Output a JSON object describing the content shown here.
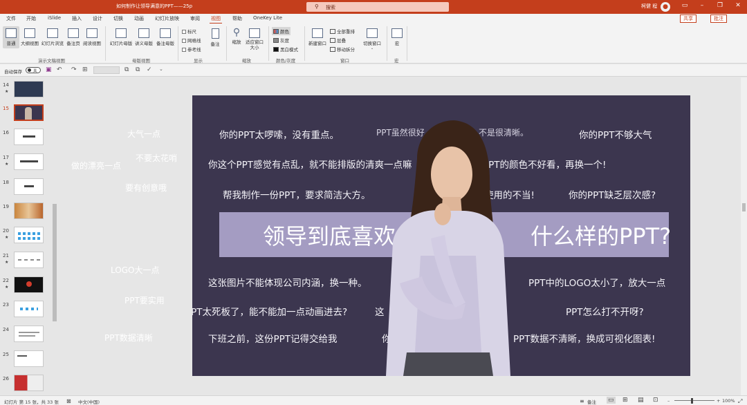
{
  "window": {
    "title": "如何制作让领导满意的PPT——25p",
    "search_placeholder": "搜索",
    "user_name": "柯健 程",
    "user_initial": "柯"
  },
  "tabs": [
    "文件",
    "开始",
    "iSlide",
    "插入",
    "设计",
    "切换",
    "动画",
    "幻灯片放映",
    "审阅",
    "视图",
    "帮助",
    "OneKey Lite"
  ],
  "active_tab": "视图",
  "share_label": "共享",
  "comments_label": "批注",
  "ribbon": {
    "presentation_views": {
      "label": "演示文稿视图",
      "buttons": [
        "普通",
        "大纲视图",
        "幻灯片浏览",
        "备注页",
        "阅读视图"
      ]
    },
    "master_views": {
      "label": "母版视图",
      "buttons": [
        "幻灯片母版",
        "讲义母版",
        "备注母版"
      ]
    },
    "show": {
      "label": "显示",
      "checkboxes": [
        "标尺",
        "网格线",
        "参考线"
      ],
      "notes_button": "备注"
    },
    "zoom": {
      "label": "缩放",
      "buttons": [
        "缩放",
        "适应窗口大小"
      ]
    },
    "color": {
      "label": "颜色/灰度",
      "options": [
        "颜色",
        "灰度",
        "黑白模式"
      ]
    },
    "window": {
      "label": "窗口",
      "new_window": "新建窗口",
      "options": [
        "全部重排",
        "层叠",
        "移动拆分"
      ],
      "switch_windows": "切换窗口"
    },
    "macros": {
      "label": "宏",
      "button": "宏"
    }
  },
  "quick_access": {
    "autosave_label": "自动保存",
    "autosave_state": "关"
  },
  "thumbnails": [
    {
      "num": "14",
      "star": true
    },
    {
      "num": "15",
      "star": false,
      "active": true
    },
    {
      "num": "16",
      "star": false
    },
    {
      "num": "17",
      "star": true
    },
    {
      "num": "18",
      "star": false
    },
    {
      "num": "19",
      "star": false
    },
    {
      "num": "20",
      "star": true
    },
    {
      "num": "21",
      "star": true
    },
    {
      "num": "22",
      "star": true
    },
    {
      "num": "23",
      "star": false
    },
    {
      "num": "24",
      "star": false
    },
    {
      "num": "25",
      "star": false
    },
    {
      "num": "26",
      "star": false
    }
  ],
  "slide": {
    "phrases": [
      "你的PPT太啰嗦，没有重点。",
      "PPT虽然很好",
      "不是很清晰。",
      "你的PPT不够大气",
      "你这个PPT感觉有点乱，就不能排版的清爽一点嘛",
      "PPT的颜色不好看，再换一个!",
      "帮我制作一份PPT，要求简洁大方。",
      "使用的不当!",
      "你的PPT缺乏层次感?",
      "这张图片不能体现公司内涵，换一种。",
      "PPT中的LOGO太小了，放大一点",
      "PPT太死板了，能不能加一点动画进去?",
      "这",
      "PPT怎么打不开呀?",
      "下班之前，这份PPT记得交给我",
      "你",
      "?",
      "PPT数据不清晰，换成可视化图表!"
    ],
    "outside_phrases": [
      "大气一点",
      "不要太花哨",
      "做的漂亮一点",
      "要有创意哦",
      "LOGO大一点",
      "PPT要实用",
      "PPT数据清晰"
    ],
    "banner_left": "领导到底喜欢",
    "banner_right": "什么样的PPT?"
  },
  "status": {
    "slide_info": "幻灯片 第 15 张，共 33 张",
    "language": "中文(中国)",
    "notes": "备注",
    "zoom": "100%"
  },
  "colors": {
    "accent": "#c43e1c",
    "slide_bg": "#3c364f",
    "banner": "#a49cc2"
  }
}
